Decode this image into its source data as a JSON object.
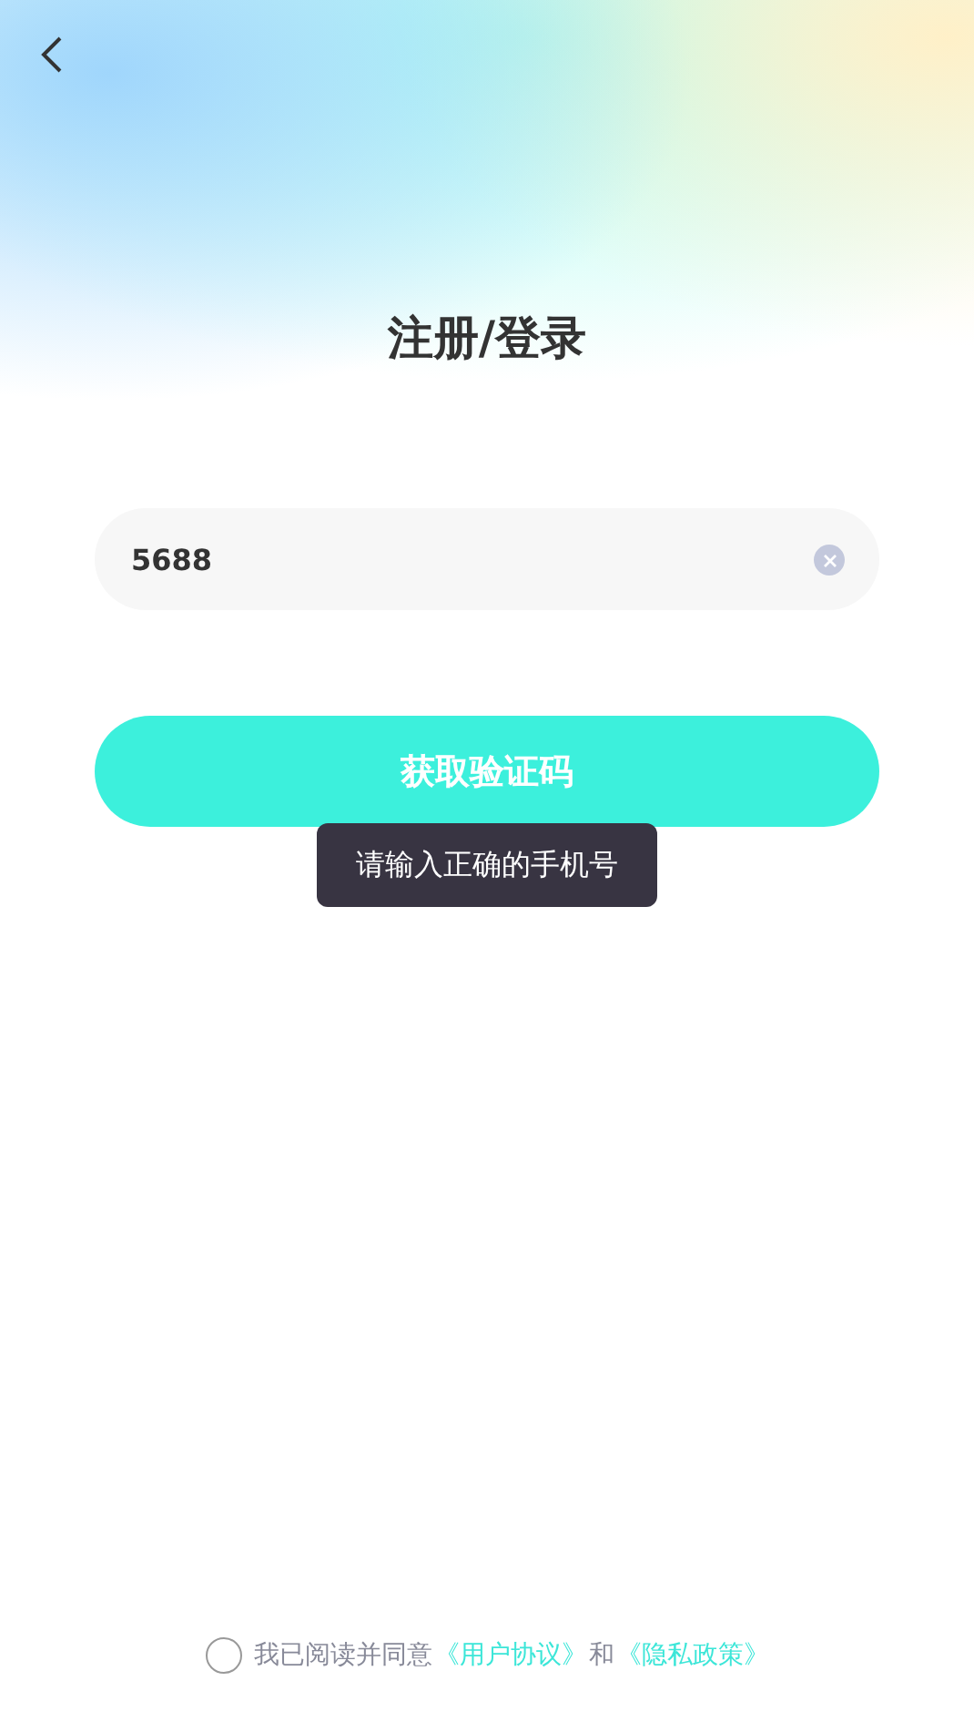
{
  "header": {
    "title": "注册/登录"
  },
  "phone_field": {
    "value": "5688"
  },
  "submit_button": {
    "label": "获取验证码"
  },
  "toast": {
    "message": "请输入正确的手机号"
  },
  "agreement": {
    "checked": false,
    "text": "我已阅读并同意",
    "links": [
      "《用户协议》",
      "《隐私政策》"
    ],
    "joiner": "和"
  }
}
